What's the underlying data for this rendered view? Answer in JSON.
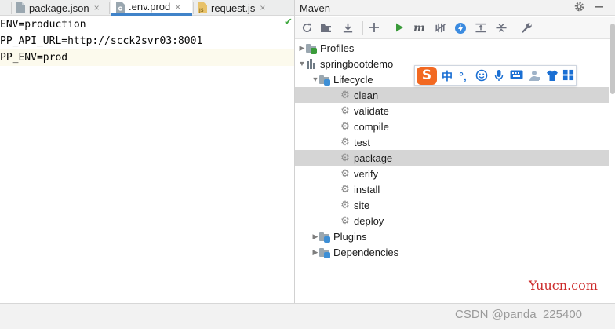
{
  "editor": {
    "tabs": [
      {
        "label": "package.json",
        "icon": "json-file-icon",
        "active": false
      },
      {
        "label": ".env.prod",
        "icon": "settings-file-icon",
        "active": true
      },
      {
        "label": "request.js",
        "icon": "js-file-icon",
        "active": false
      }
    ],
    "close_glyph": "×",
    "check_glyph": "✔",
    "lines": [
      "ENV=production",
      "PP_API_URL=http://scck2svr03:8001",
      "PP_ENV=prod"
    ]
  },
  "maven": {
    "title": "Maven",
    "header_icons": [
      "settings-gear-icon",
      "minimize-icon"
    ],
    "toolbar_icons": [
      "reload-icon",
      "add-folder-icon",
      "download-icon",
      "add-icon",
      "run-icon",
      "maven-goal-icon",
      "toggle-offline-icon",
      "skip-tests-icon",
      "show-dependencies-icon",
      "collapse-all-icon",
      "settings-wrench-icon"
    ],
    "tree": {
      "profiles": "Profiles",
      "project": "springbootdemo",
      "lifecycle": "Lifecycle",
      "phases": [
        "clean",
        "validate",
        "compile",
        "test",
        "package",
        "verify",
        "install",
        "site",
        "deploy"
      ],
      "selected_phases": [
        "clean",
        "package"
      ],
      "plugins": "Plugins",
      "dependencies": "Dependencies"
    }
  },
  "ime": {
    "logo": "S",
    "chinese_mode": "中",
    "punct": "°,",
    "icons": [
      "emoji-icon",
      "microphone-icon",
      "keyboard-icon",
      "user-icon",
      "skin-icon",
      "grid-icon"
    ]
  },
  "watermarks": {
    "site": "Yuucn.com",
    "csdn": "CSDN @panda_225400"
  },
  "colors": {
    "accent": "#4083c9",
    "run_green": "#3a9b3a",
    "ime_orange": "#f26922",
    "ime_blue": "#1a6fd3",
    "selection": "#d5d5d5",
    "watermark_red": "#cc2a2a"
  }
}
